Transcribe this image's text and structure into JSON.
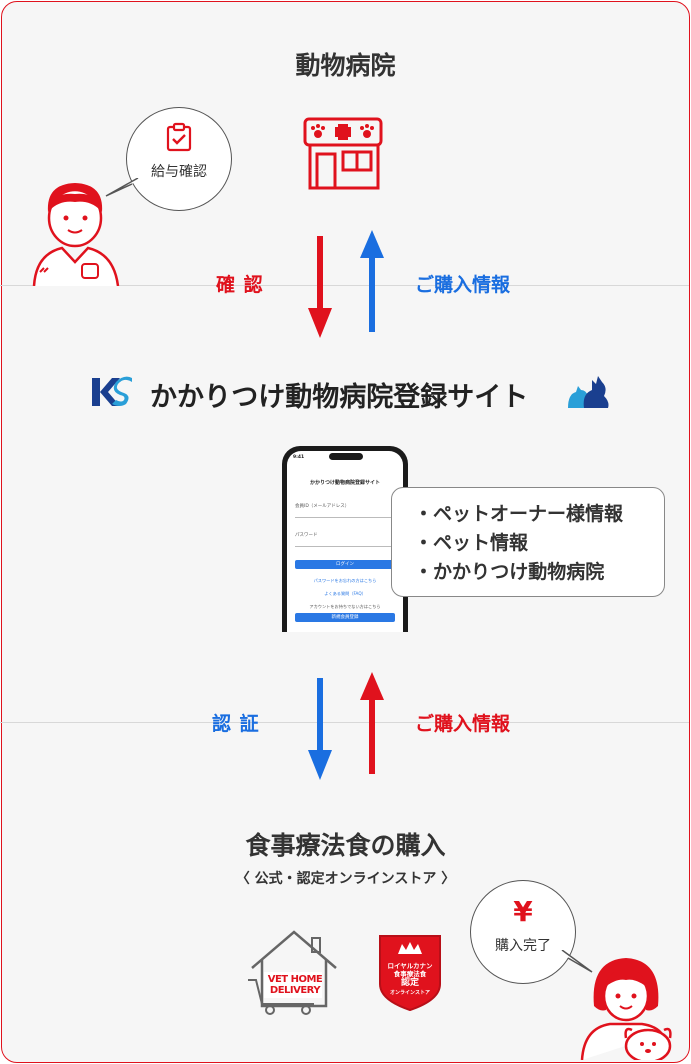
{
  "clinic": {
    "title": "動物病院",
    "bubble_text": "給与確認"
  },
  "flow_top": {
    "left_label": "確 認",
    "right_label": "ご購入情報"
  },
  "site": {
    "logo_text": "KS",
    "title": "かかりつけ動物病院登録サイト"
  },
  "phone": {
    "time": "9:41",
    "header": "かかりつけ動物病院登録サイト",
    "id_label": "会員ID（メールアドレス）",
    "pw_label": "パスワード",
    "login_button": "ログイン",
    "forgot_link": "パスワードをお忘れの方はこちら",
    "faq_link": "よくある質問（FAQ）",
    "no_account": "アカウントをお持ちでない方はこちら",
    "register_button": "新規会員登録"
  },
  "info_list": [
    "・ペットオーナー様情報",
    "・ペット情報",
    "・かかりつけ動物病院"
  ],
  "flow_bottom": {
    "left_label": "認 証",
    "right_label": "ご購入情報"
  },
  "purchase": {
    "title": "食事療法食の購入",
    "subtitle": "〈 公式・認定オンラインストア 〉",
    "bubble_symbol": "¥",
    "bubble_text": "購入完了",
    "vet_logo": "VET HOME DELIVERY",
    "rc_line1": "ロイヤルカナン",
    "rc_line2": "食事療法食",
    "rc_line3": "認定",
    "rc_line4": "オンラインストア"
  },
  "colors": {
    "red": "#e0121d",
    "blue": "#1a6ee0"
  }
}
